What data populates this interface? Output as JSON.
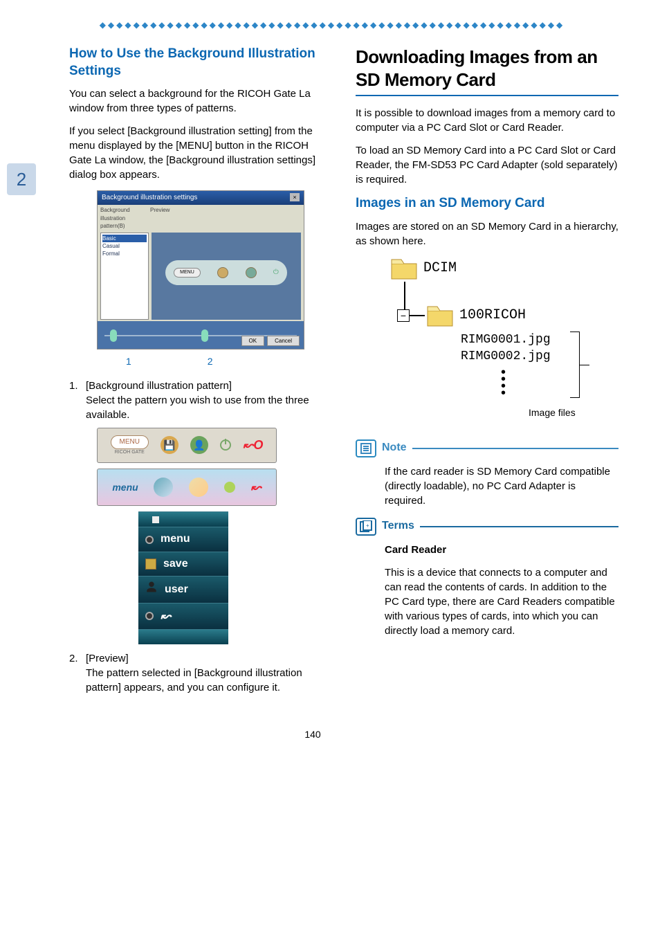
{
  "tab_number": "2",
  "left": {
    "heading": "How to Use the Background Illustration Settings",
    "p1": "You can select a background for the RICOH Gate La window from three types of patterns.",
    "p2": "If you select [Background illustration setting] from the menu displayed by the [MENU] button in the RICOH Gate La window, the [Background illustration settings] dialog box appears.",
    "dialog": {
      "title": "Background illustration settings",
      "list_header_left": "Background illustration pattern(B)",
      "list_header_right": "Preview",
      "items": [
        "Basic",
        "Casual",
        "Formal"
      ],
      "menu_btn": "MENU",
      "ok": "OK",
      "cancel": "Cancel",
      "callout_1": "1",
      "callout_2": "2"
    },
    "item1_num": "1.",
    "item1_title": "[Background illustration pattern]",
    "item1_body": "Select the pattern you wish to use from the three available.",
    "pattern1": {
      "menu": "MENU",
      "sublabel": "RICOH GATE"
    },
    "pattern2": {
      "menu": "menu"
    },
    "pattern3": {
      "rows": [
        "menu",
        "save",
        "user"
      ]
    },
    "item2_num": "2.",
    "item2_title": "[Preview]",
    "item2_body": "The pattern selected in [Background illustration pattern] appears, and you can configure it."
  },
  "right": {
    "heading": "Downloading Images from an SD Memory Card",
    "p1": "It is possible to download images from a memory card to computer via a PC Card Slot or Card Reader.",
    "p2": "To load an SD Memory Card into a PC Card Slot or Card Reader, the FM-SD53 PC Card Adapter (sold separately) is required.",
    "sub_heading": "Images in an SD Memory Card",
    "p3": "Images are stored on an SD Memory Card in a hierarchy, as shown here.",
    "diagram": {
      "root": "DCIM",
      "child": "100RICOH",
      "files": [
        "RIMG0001.jpg",
        "RIMG0002.jpg"
      ],
      "files_label": "Image files"
    },
    "note_label": "Note",
    "note_body": "If the card reader is SD Memory Card compatible (directly loadable), no PC Card Adapter is required.",
    "terms_label": "Terms",
    "terms_title": "Card Reader",
    "terms_body": "This is a device that connects to a computer and can read the contents of cards. In addition to the PC Card type, there are Card Readers compatible with various types of cards, into which you can directly load a memory card."
  },
  "footer_page": "140"
}
